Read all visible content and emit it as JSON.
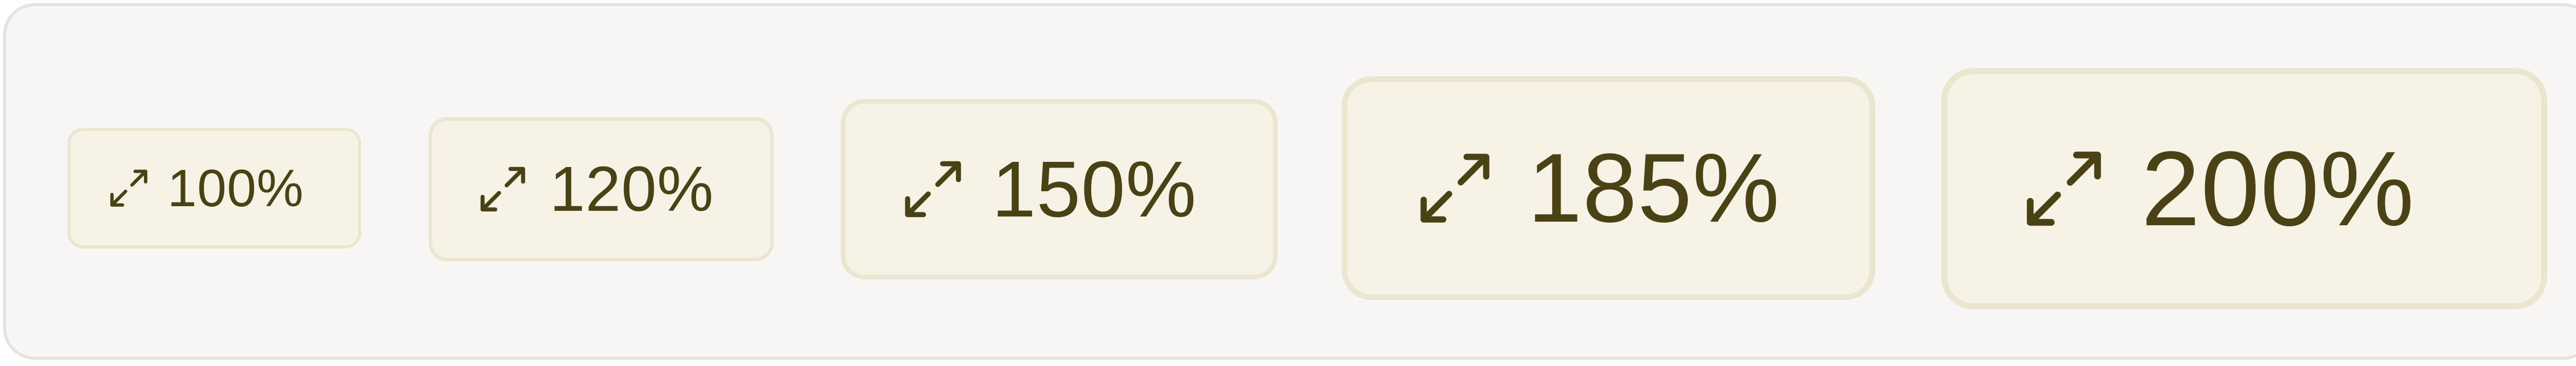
{
  "zoom_buttons": [
    {
      "label": "100%",
      "icon": "expand-diagonal-icon"
    },
    {
      "label": "120%",
      "icon": "expand-diagonal-icon"
    },
    {
      "label": "150%",
      "icon": "expand-diagonal-icon"
    },
    {
      "label": "185%",
      "icon": "expand-diagonal-icon"
    },
    {
      "label": "200%",
      "icon": "expand-diagonal-icon"
    }
  ],
  "colors": {
    "chip_background": "#f6f2e6",
    "chip_border": "#ebe6cf",
    "text": "#4a4214",
    "panel_background": "#f8f7f6",
    "panel_border": "#e6e4e1"
  }
}
